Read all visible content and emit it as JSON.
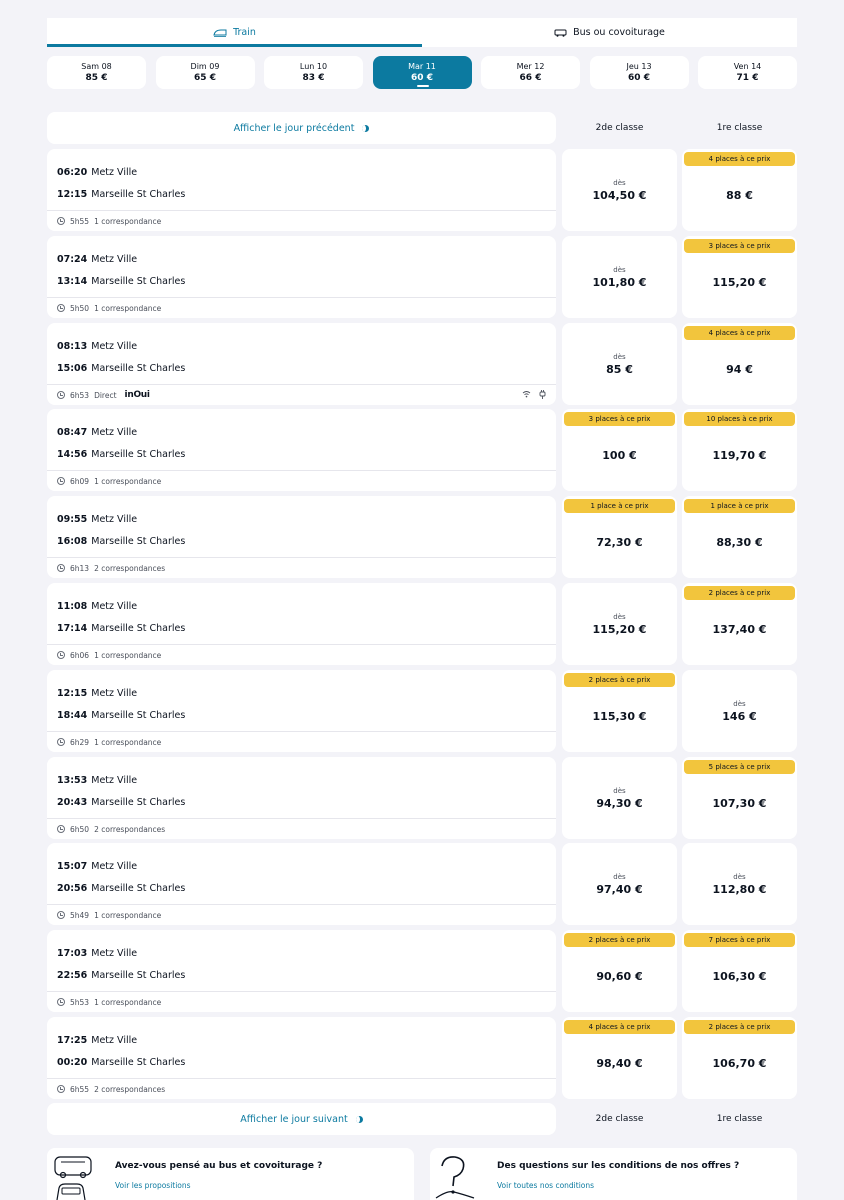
{
  "tabs": [
    {
      "label": "Train",
      "icon": "train-icon",
      "active": true
    },
    {
      "label": "Bus ou covoiturage",
      "icon": "bus-icon",
      "active": false
    }
  ],
  "dates": [
    {
      "day": "Sam 08",
      "price": "85 €"
    },
    {
      "day": "Dim 09",
      "price": "65 €"
    },
    {
      "day": "Lun 10",
      "price": "83 €"
    },
    {
      "day": "Mar 11",
      "price": "60 €",
      "active": true
    },
    {
      "day": "Mer 12",
      "price": "66 €"
    },
    {
      "day": "Jeu 13",
      "price": "60 €"
    },
    {
      "day": "Ven 14",
      "price": "71 €"
    }
  ],
  "prev_label": "Afficher le jour précédent",
  "next_label": "Afficher le jour suivant",
  "class_headers": {
    "second": "2de classe",
    "first": "1re classe"
  },
  "des_label": "dès",
  "journeys": [
    {
      "dep_time": "06:20",
      "dep_station": "Metz Ville",
      "arr_time": "12:15",
      "arr_station": "Marseille St Charles",
      "duration": "5h55",
      "connections": "1 correspondance",
      "second": {
        "badge": "",
        "des": true,
        "price": "104,50 €"
      },
      "first": {
        "badge": "4 places à ce prix",
        "des": false,
        "price": "88 €"
      }
    },
    {
      "dep_time": "07:24",
      "dep_station": "Metz Ville",
      "arr_time": "13:14",
      "arr_station": "Marseille St Charles",
      "duration": "5h50",
      "connections": "1 correspondance",
      "second": {
        "badge": "",
        "des": true,
        "price": "101,80 €"
      },
      "first": {
        "badge": "3 places à ce prix",
        "des": false,
        "price": "115,20 €"
      }
    },
    {
      "dep_time": "08:13",
      "dep_station": "Metz Ville",
      "arr_time": "15:06",
      "arr_station": "Marseille St Charles",
      "duration": "6h53",
      "connections": "Direct",
      "brand": "inOui",
      "amenities": true,
      "second": {
        "badge": "",
        "des": true,
        "price": "85 €"
      },
      "first": {
        "badge": "4 places à ce prix",
        "des": false,
        "price": "94 €"
      }
    },
    {
      "dep_time": "08:47",
      "dep_station": "Metz Ville",
      "arr_time": "14:56",
      "arr_station": "Marseille St Charles",
      "duration": "6h09",
      "connections": "1 correspondance",
      "second": {
        "badge": "3 places à ce prix",
        "des": false,
        "price": "100 €"
      },
      "first": {
        "badge": "10 places à ce prix",
        "des": false,
        "price": "119,70 €"
      }
    },
    {
      "dep_time": "09:55",
      "dep_station": "Metz Ville",
      "arr_time": "16:08",
      "arr_station": "Marseille St Charles",
      "duration": "6h13",
      "connections": "2 correspondances",
      "second": {
        "badge": "1 place à ce prix",
        "des": false,
        "price": "72,30 €"
      },
      "first": {
        "badge": "1 place à ce prix",
        "des": false,
        "price": "88,30 €"
      }
    },
    {
      "dep_time": "11:08",
      "dep_station": "Metz Ville",
      "arr_time": "17:14",
      "arr_station": "Marseille St Charles",
      "duration": "6h06",
      "connections": "1 correspondance",
      "second": {
        "badge": "",
        "des": true,
        "price": "115,20 €"
      },
      "first": {
        "badge": "2 places à ce prix",
        "des": false,
        "price": "137,40 €"
      }
    },
    {
      "dep_time": "12:15",
      "dep_station": "Metz Ville",
      "arr_time": "18:44",
      "arr_station": "Marseille St Charles",
      "duration": "6h29",
      "connections": "1 correspondance",
      "second": {
        "badge": "2 places à ce prix",
        "des": false,
        "price": "115,30 €"
      },
      "first": {
        "badge": "",
        "des": true,
        "price": "146 €"
      }
    },
    {
      "dep_time": "13:53",
      "dep_station": "Metz Ville",
      "arr_time": "20:43",
      "arr_station": "Marseille St Charles",
      "duration": "6h50",
      "connections": "2 correspondances",
      "second": {
        "badge": "",
        "des": true,
        "price": "94,30 €"
      },
      "first": {
        "badge": "5 places à ce prix",
        "des": false,
        "price": "107,30 €"
      }
    },
    {
      "dep_time": "15:07",
      "dep_station": "Metz Ville",
      "arr_time": "20:56",
      "arr_station": "Marseille St Charles",
      "duration": "5h49",
      "connections": "1 correspondance",
      "second": {
        "badge": "",
        "des": true,
        "price": "97,40 €"
      },
      "first": {
        "badge": "",
        "des": true,
        "price": "112,80 €"
      }
    },
    {
      "dep_time": "17:03",
      "dep_station": "Metz Ville",
      "arr_time": "22:56",
      "arr_station": "Marseille St Charles",
      "duration": "5h53",
      "connections": "1 correspondance",
      "second": {
        "badge": "2 places à ce prix",
        "des": false,
        "price": "90,60 €"
      },
      "first": {
        "badge": "7 places à ce prix",
        "des": false,
        "price": "106,30 €"
      }
    },
    {
      "dep_time": "17:25",
      "dep_station": "Metz Ville",
      "arr_time": "00:20",
      "arr_station": "Marseille St Charles",
      "duration": "6h55",
      "connections": "2 correspondances",
      "second": {
        "badge": "4 places à ce prix",
        "des": false,
        "price": "98,40 €"
      },
      "first": {
        "badge": "2 places à ce prix",
        "des": false,
        "price": "106,70 €"
      }
    }
  ],
  "promos": [
    {
      "title": "Avez-vous pensé au bus et covoiturage ?",
      "link": "Voir les propositions",
      "icon": "bus-car-illustration"
    },
    {
      "title": "Des questions sur les conditions de nos offres ?",
      "link": "Voir toutes nos conditions",
      "icon": "question-illustration"
    }
  ],
  "colors": {
    "accent": "#0c7aa0",
    "badge": "#f2c53d",
    "background": "#f3f3f8"
  }
}
